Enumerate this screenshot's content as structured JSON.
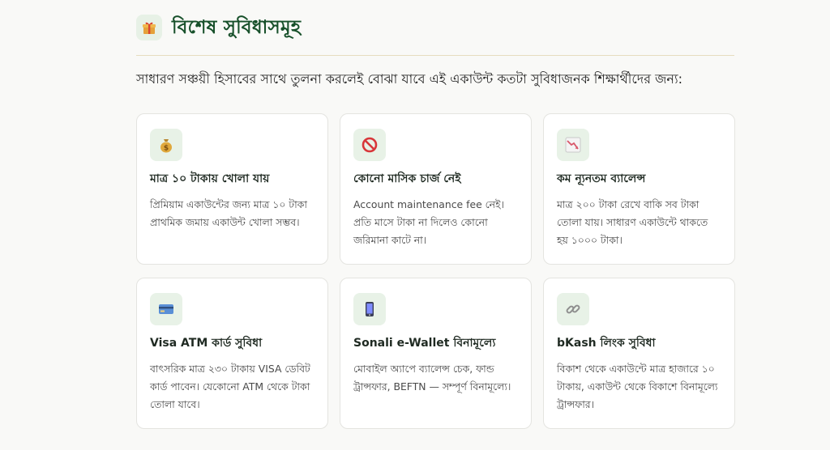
{
  "section": {
    "icon": "gift-icon",
    "title": "বিশেষ সুবিধাসমূহ",
    "intro": "সাধারণ সঞ্চয়ী হিসাবের সাথে তুলনা করলেই বোঝা যাবে এই একাউন্ট কতটা সুবিধাজনক শিক্ষার্থীদের জন্য:"
  },
  "cards": [
    {
      "icon": "money-bag-icon",
      "title": "মাত্র ১০ টাকায় খোলা যায়",
      "desc": "প্রিমিয়াম একাউন্টের জন্য মাত্র ১০ টাকা প্রাথমিক জমায় একাউন্ট খোলা সম্ভব।"
    },
    {
      "icon": "prohibited-icon",
      "title": "কোনো মাসিক চার্জ নেই",
      "desc": "Account maintenance fee নেই। প্রতি মাসে টাকা না দিলেও কোনো জরিমানা কাটে না।"
    },
    {
      "icon": "chart-decreasing-icon",
      "title": "কম ন্যূনতম ব্যালেন্স",
      "desc": "মাত্র ২০০ টাকা রেখে বাকি সব টাকা তোলা যায়। সাধারণ একাউন্টে থাকতে হয় ১০০০ টাকা।"
    },
    {
      "icon": "credit-card-icon",
      "title": "Visa ATM কার্ড সুবিধা",
      "desc": "বাৎসরিক মাত্র ২৩০ টাকায় VISA ডেবিট কার্ড পাবেন। যেকোনো ATM থেকে টাকা তোলা যাবে।"
    },
    {
      "icon": "mobile-phone-icon",
      "title": "Sonali e-Wallet বিনামূল্যে",
      "desc": "মোবাইল অ্যাপে ব্যালেন্স চেক, ফান্ড ট্রান্সফার, BEFTN — সম্পূর্ণ বিনামূল্যে।"
    },
    {
      "icon": "link-icon",
      "title": "bKash লিংক সুবিধা",
      "desc": "বিকাশ থেকে একাউন্টে মাত্র হাজারে ১০ টাকায়, একাউন্ট থেকে বিকাশে বিনামূল্যে ট্রান্সফার।"
    }
  ]
}
